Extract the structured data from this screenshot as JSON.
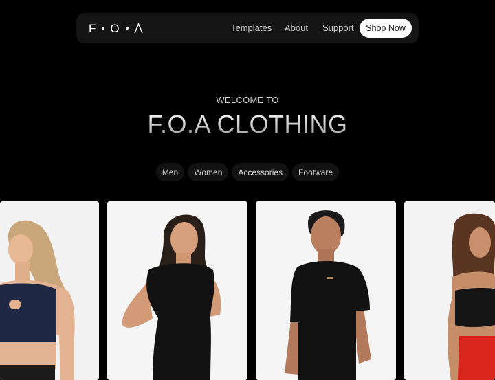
{
  "nav": {
    "logo_text": "F·O·A",
    "links": [
      {
        "label": "Templates"
      },
      {
        "label": "About"
      },
      {
        "label": "Support"
      }
    ],
    "cta_label": "Shop Now"
  },
  "hero": {
    "eyebrow": "WELCOME TO",
    "title": "F.O.A CLOTHING"
  },
  "categories": [
    {
      "label": "Men"
    },
    {
      "label": "Women"
    },
    {
      "label": "Accessories"
    },
    {
      "label": "Footware"
    }
  ],
  "products": [
    {
      "subject": "woman in navy cutout sports top"
    },
    {
      "subject": "woman in black fitted bodysuit"
    },
    {
      "subject": "man in black oversized t-shirt"
    },
    {
      "subject": "woman in black crop top and red pants"
    }
  ],
  "colors": {
    "background": "#000000",
    "nav_bg": "#141414",
    "chip_bg": "#121212",
    "cta_bg": "#ffffff"
  }
}
